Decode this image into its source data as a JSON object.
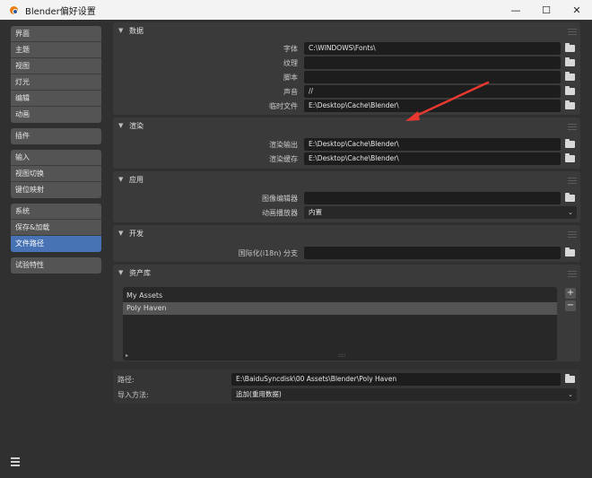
{
  "window": {
    "title": "Blender偏好设置",
    "minimize": "—",
    "maximize": "☐",
    "close": "✕"
  },
  "sidebar": {
    "groups": [
      [
        "界面",
        "主题",
        "视图",
        "灯光",
        "编辑",
        "动画"
      ],
      [
        "插件"
      ],
      [
        "输入",
        "视图切换",
        "键位映射"
      ],
      [
        "系统",
        "保存&加载",
        "文件路径"
      ],
      [
        "试验特性"
      ]
    ],
    "active": "文件路径"
  },
  "sections": {
    "data": {
      "title": "数据",
      "rows": [
        {
          "label": "字体",
          "value": "C:\\WINDOWS\\Fonts\\"
        },
        {
          "label": "纹理",
          "value": ""
        },
        {
          "label": "脚本",
          "value": ""
        },
        {
          "label": "声音",
          "value": "//"
        },
        {
          "label": "临时文件",
          "value": "E:\\Desktop\\Cache\\Blender\\"
        }
      ]
    },
    "render": {
      "title": "渲染",
      "rows": [
        {
          "label": "渲染输出",
          "value": "E:\\Desktop\\Cache\\Blender\\"
        },
        {
          "label": "渲染缓存",
          "value": "E:\\Desktop\\Cache\\Blender\\"
        }
      ]
    },
    "apps": {
      "title": "应用",
      "image_editor_label": "图像编辑器",
      "image_editor_value": "",
      "anim_player_label": "动画播放器",
      "anim_player_value": "内置"
    },
    "dev": {
      "title": "开发",
      "i18n_label": "国际化(i18n) 分支",
      "i18n_value": ""
    },
    "assets": {
      "title": "资产库",
      "libraries": [
        "My Assets",
        "Poly Haven"
      ],
      "selected": "Poly Haven",
      "add": "+",
      "remove": "−",
      "path_label": "路径:",
      "path_value": "E:\\BaiduSyncdisk\\00 Assets\\Blender\\Poly Haven",
      "import_label": "导入方法:",
      "import_value": "追加(重用数据)"
    }
  },
  "colors": {
    "accent": "#4772b3",
    "arrow": "#e8382f",
    "panel": "#303030",
    "field": "#1d1d1d"
  }
}
